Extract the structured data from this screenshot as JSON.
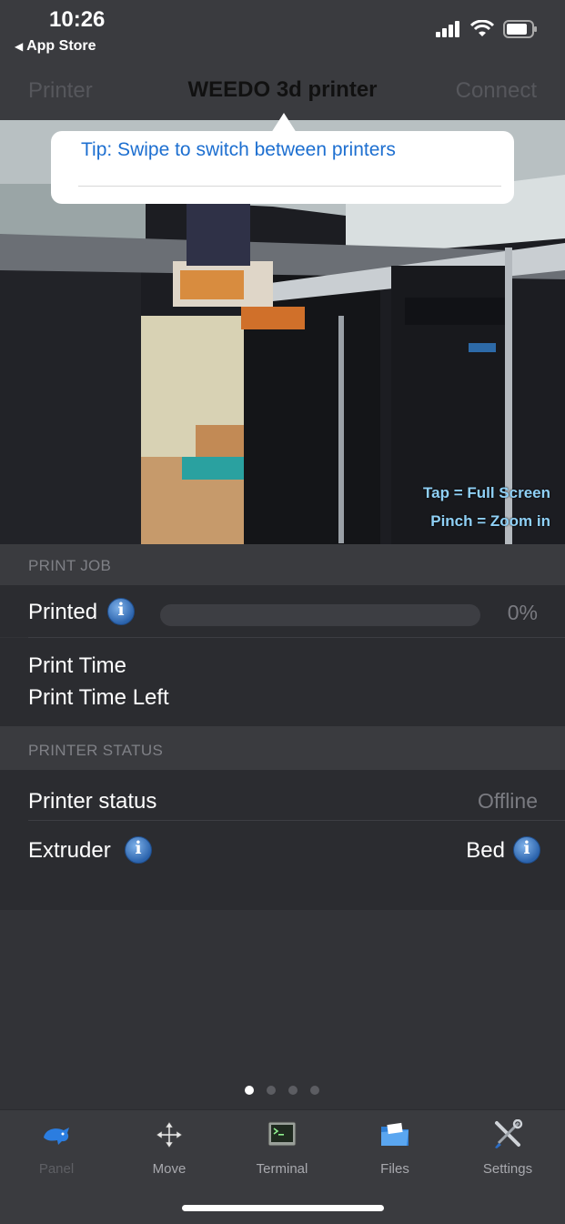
{
  "status_bar": {
    "time": "10:26",
    "back_label": "App Store"
  },
  "nav": {
    "left": "Printer",
    "title": "WEEDO 3d printer",
    "right": "Connect"
  },
  "tip": {
    "text": "Tip: Swipe to switch between printers"
  },
  "camera": {
    "hint_tap": "Tap = Full Screen",
    "hint_pinch": "Pinch = Zoom in"
  },
  "print_job": {
    "header": "PRINT JOB",
    "printed_label": "Printed",
    "printed_value": "0%",
    "progress_fraction": 0,
    "print_time_label": "Print Time",
    "print_time_left_label": "Print Time Left"
  },
  "printer_status": {
    "header": "PRINTER STATUS",
    "status_label": "Printer status",
    "status_value": "Offline",
    "extruder_label": "Extruder",
    "bed_label": "Bed"
  },
  "page_dots": {
    "count": 4,
    "active": 0
  },
  "tabs": [
    {
      "label": "Panel",
      "icon": "dolphin-icon",
      "active": true
    },
    {
      "label": "Move",
      "icon": "move-arrows-icon",
      "active": false
    },
    {
      "label": "Terminal",
      "icon": "terminal-icon",
      "active": false
    },
    {
      "label": "Files",
      "icon": "folder-icon",
      "active": false
    },
    {
      "label": "Settings",
      "icon": "wrench-screwdriver-icon",
      "active": false
    }
  ],
  "colors": {
    "accent": "#1d6fd0",
    "hint": "#8fd0f6",
    "background": "#323337"
  }
}
